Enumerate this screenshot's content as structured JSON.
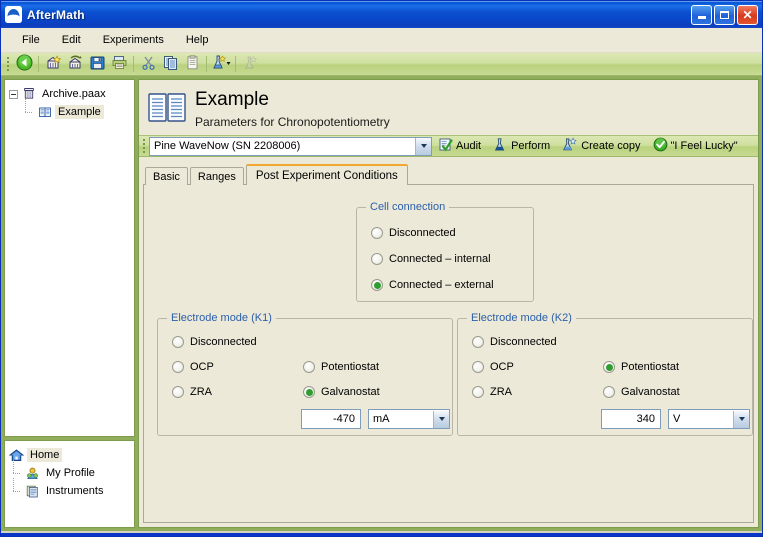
{
  "window": {
    "title": "AfterMath",
    "app_icon": "aftermath-logo-icon",
    "minimize_label": "",
    "maximize_label": "",
    "close_label": "✕"
  },
  "menubar": {
    "items": [
      {
        "label": "File"
      },
      {
        "label": "Edit"
      },
      {
        "label": "Experiments"
      },
      {
        "label": "Help"
      }
    ]
  },
  "toolbar": {
    "buttons": [
      {
        "name": "back-icon",
        "title": "Back"
      },
      {
        "name": "new-archive-icon",
        "title": "New archive"
      },
      {
        "name": "open-archive-icon",
        "title": "Open archive"
      },
      {
        "name": "save-icon",
        "title": "Save"
      },
      {
        "name": "print-icon",
        "title": "Print"
      },
      {
        "name": "cut-icon",
        "title": "Cut"
      },
      {
        "name": "copy-icon",
        "title": "Copy"
      },
      {
        "name": "paste-icon",
        "title": "Paste"
      },
      {
        "name": "wizard-icon",
        "title": "Experiment wizard"
      },
      {
        "name": "wizard-disabled-icon",
        "title": "Disabled"
      }
    ]
  },
  "sidebar": {
    "archive_tree": {
      "root": {
        "label": "Archive.paax",
        "icon": "archive-icon",
        "expanded": true
      },
      "children": [
        {
          "label": "Example",
          "icon": "book-icon",
          "selected": true
        }
      ]
    },
    "nav_tree": {
      "root": {
        "label": "Home",
        "icon": "home-icon",
        "selected": true
      },
      "children": [
        {
          "label": "My Profile",
          "icon": "profile-icon"
        },
        {
          "label": "Instruments",
          "icon": "instruments-icon"
        }
      ]
    }
  },
  "document": {
    "icon": "open-book-icon",
    "title": "Example",
    "subtitle": "Parameters for Chronopotentiometry"
  },
  "instrument_bar": {
    "selected_instrument": "Pine WaveNow (SN 2208006)",
    "actions": [
      {
        "label": "Audit",
        "icon": "audit-icon"
      },
      {
        "label": "Perform",
        "icon": "perform-icon"
      },
      {
        "label": "Create copy",
        "icon": "create-copy-icon"
      },
      {
        "label": "\"I Feel Lucky\"",
        "icon": "lucky-check-icon"
      }
    ]
  },
  "tabs": [
    {
      "label": "Basic",
      "active": false
    },
    {
      "label": "Ranges",
      "active": false
    },
    {
      "label": "Post Experiment Conditions",
      "active": true
    }
  ],
  "cell_connection": {
    "title": "Cell connection",
    "options": [
      {
        "label": "Disconnected",
        "selected": false
      },
      {
        "label": "Connected – internal",
        "selected": false
      },
      {
        "label": "Connected – external",
        "selected": true
      }
    ]
  },
  "electrode_k1": {
    "title": "Electrode mode (K1)",
    "left_options": [
      {
        "label": "Disconnected",
        "selected": false
      },
      {
        "label": "OCP",
        "selected": false
      },
      {
        "label": "ZRA",
        "selected": false
      }
    ],
    "right_options": [
      {
        "label": "Potentiostat",
        "selected": false
      },
      {
        "label": "Galvanostat",
        "selected": true
      }
    ],
    "value": "-470",
    "unit": "mA"
  },
  "electrode_k2": {
    "title": "Electrode mode (K2)",
    "left_options": [
      {
        "label": "Disconnected",
        "selected": false
      },
      {
        "label": "OCP",
        "selected": false
      },
      {
        "label": "ZRA",
        "selected": false
      }
    ],
    "right_options": [
      {
        "label": "Potentiostat",
        "selected": true
      },
      {
        "label": "Galvanostat",
        "selected": false
      }
    ],
    "value": "340",
    "unit": "V"
  },
  "colors": {
    "titlebar_blue": "#0a46c9",
    "toolbar_green": "#c7da92",
    "panel_beige": "#ece9d8",
    "group_label_blue": "#2b5faa",
    "active_tab_accent": "#f0a830",
    "radio_dot_green": "#2f9e2f",
    "frame_green": "#8fad5b"
  }
}
